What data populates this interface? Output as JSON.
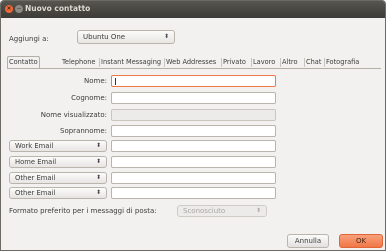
{
  "window": {
    "title": "Nuovo contatto"
  },
  "add_to": {
    "label": "Aggiungi a:",
    "value": "Ubuntu One"
  },
  "tabs": [
    "Contatto",
    "Telephone",
    "Instant Messaging",
    "Web Addresses",
    "Privato",
    "Lavoro",
    "Altro",
    "Chat",
    "Fotografia"
  ],
  "fields": {
    "nome": {
      "label": "Nome:",
      "value": ""
    },
    "cognome": {
      "label": "Cognome:",
      "value": ""
    },
    "nome_visualizzato": {
      "label": "Nome visualizzato:",
      "value": ""
    },
    "soprannome": {
      "label": "Soprannome:",
      "value": ""
    }
  },
  "emails": [
    {
      "type": "Work Email",
      "value": ""
    },
    {
      "type": "Home Email",
      "value": ""
    },
    {
      "type": "Other Email",
      "value": ""
    },
    {
      "type": "Other Email",
      "value": ""
    }
  ],
  "preferred_format": {
    "label": "Formato preferito per i messaggi di posta:",
    "value": "Sconosciuto"
  },
  "buttons": {
    "cancel": "Annulla",
    "ok": "OK"
  },
  "colors": {
    "accent": "#f07746",
    "titlebar": "#3c3b37",
    "background": "#f2f1f0"
  },
  "icons": {
    "close": "close-icon",
    "minimize": "minimize-icon",
    "combo": "updown-arrows-icon"
  }
}
